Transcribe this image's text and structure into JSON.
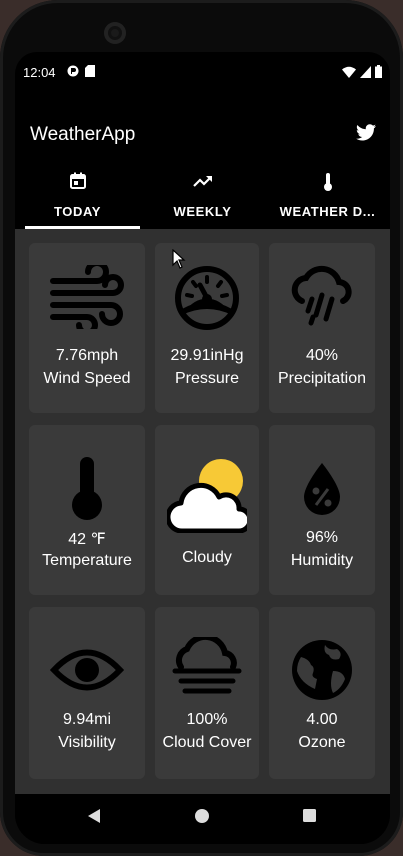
{
  "status": {
    "time": "12:04"
  },
  "app": {
    "title": "WeatherApp"
  },
  "tabs": [
    {
      "label": "TODAY",
      "icon": "calendar-icon",
      "selected": true
    },
    {
      "label": "WEEKLY",
      "icon": "trending-up-icon",
      "selected": false
    },
    {
      "label": "WEATHER D...",
      "icon": "thermometer-icon",
      "selected": false
    }
  ],
  "cards": [
    {
      "value": "7.76mph",
      "label": "Wind Speed",
      "icon": "wind-icon"
    },
    {
      "value": "29.91inHg",
      "label": "Pressure",
      "icon": "gauge-icon"
    },
    {
      "value": "40%",
      "label": "Precipitation",
      "icon": "rain-cloud-icon"
    },
    {
      "value": "42 ℉",
      "label": "Temperature",
      "icon": "thermometer-icon"
    },
    {
      "value": "",
      "label": "Cloudy",
      "icon": "partly-cloudy-icon"
    },
    {
      "value": "96%",
      "label": "Humidity",
      "icon": "humidity-drop-icon"
    },
    {
      "value": "9.94mi",
      "label": "Visibility",
      "icon": "eye-icon"
    },
    {
      "value": "100%",
      "label": "Cloud Cover",
      "icon": "fog-cloud-icon"
    },
    {
      "value": "4.00",
      "label": "Ozone",
      "icon": "globe-icon"
    }
  ],
  "colors": {
    "background": "#303030",
    "card": "#3a3a3a",
    "sun": "#f7c936",
    "text": "#ffffff"
  }
}
